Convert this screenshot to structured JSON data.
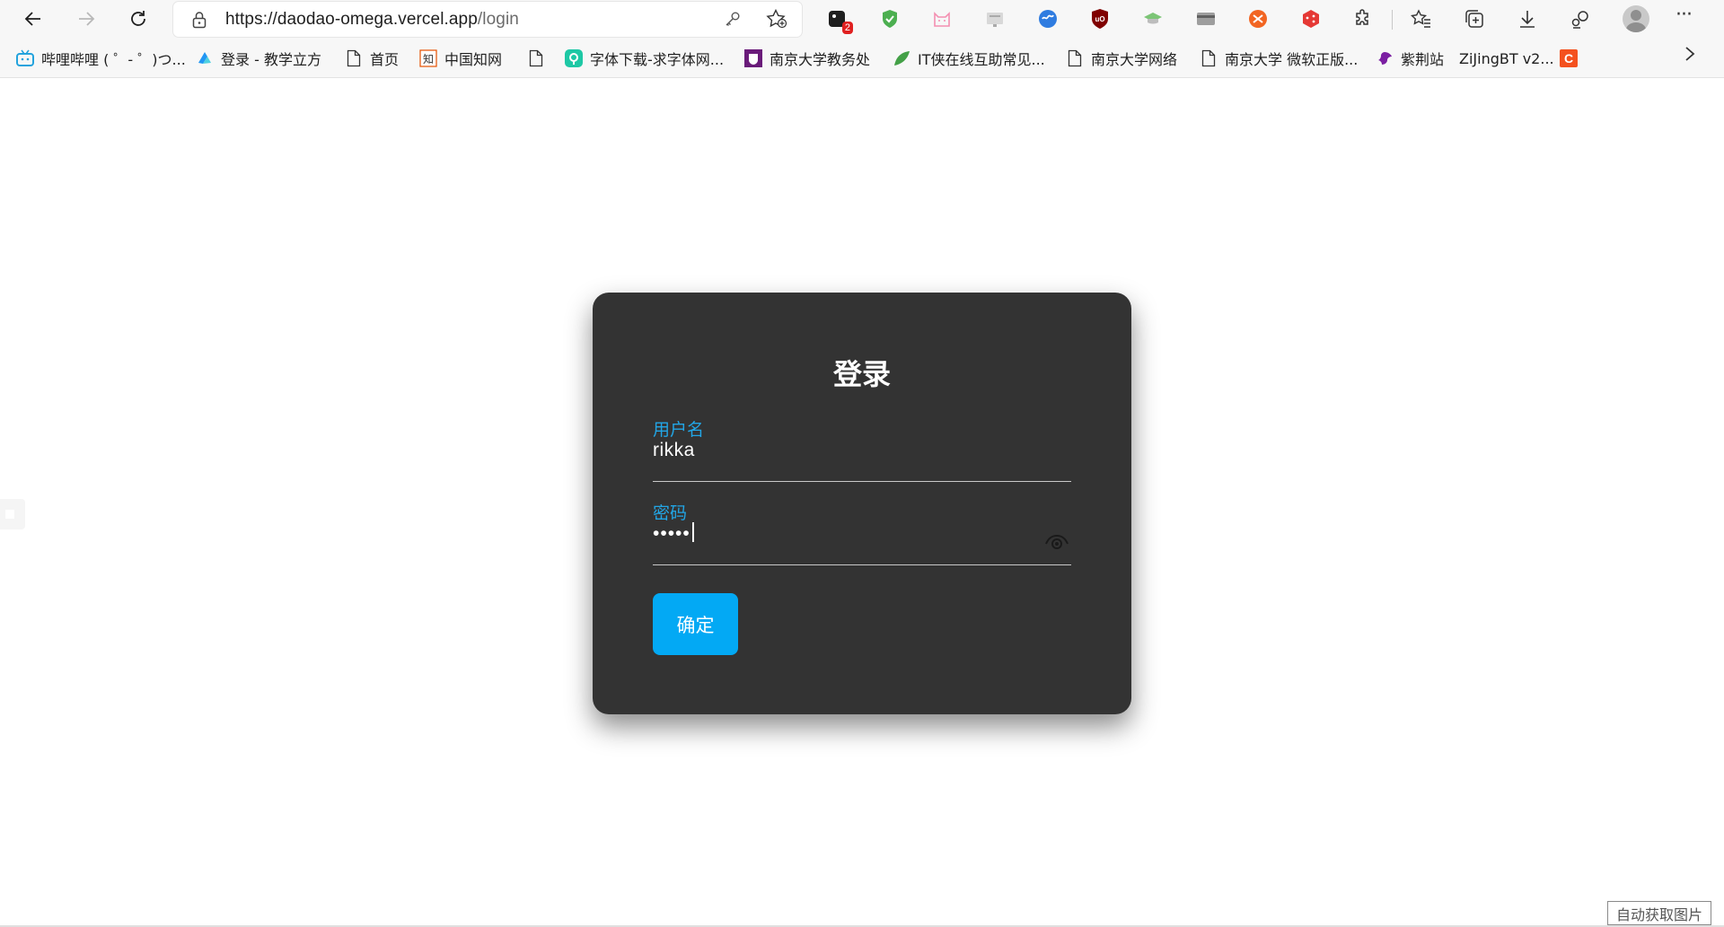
{
  "browser": {
    "url_host": "https://daodao-omega.vercel.app",
    "url_path": "/login",
    "extensions": [
      {
        "icon": "extension-notes-icon",
        "badge": "2"
      },
      {
        "icon": "shield-extension-icon"
      },
      {
        "icon": "cat-extension-icon"
      },
      {
        "icon": "reader-extension-icon"
      },
      {
        "icon": "translate-extension-icon"
      },
      {
        "icon": "ublock-origin-icon"
      },
      {
        "icon": "graduation-cap-icon"
      },
      {
        "icon": "card-extension-icon"
      },
      {
        "icon": "orange-extension-icon"
      },
      {
        "icon": "dice-extension-icon"
      },
      {
        "icon": "puzzle-extensions-icon"
      }
    ]
  },
  "bookmarks": [
    {
      "label": "哔哩哔哩 ( ゜- ゜)つ...",
      "icon": "bilibili-icon"
    },
    {
      "label": "登录 - 教学立方",
      "icon": "teaching-cube-icon"
    },
    {
      "label": "首页",
      "icon": "page-icon"
    },
    {
      "label": "中国知网",
      "icon": "cnki-icon"
    },
    {
      "label": "",
      "icon": "page-icon"
    },
    {
      "label": "字体下载-求字体网...",
      "icon": "qiuziti-icon"
    },
    {
      "label": "南京大学教务处",
      "icon": "nju-icon"
    },
    {
      "label": "IT侠在线互助常见...",
      "icon": "itxia-icon"
    },
    {
      "label": "南京大学网络",
      "icon": "page-icon"
    },
    {
      "label": "南京大学 微软正版...",
      "icon": "page-icon"
    },
    {
      "label": "紫荆站",
      "icon": "zijing-icon"
    },
    {
      "label": "ZiJingBT v2...",
      "icon": ""
    },
    {
      "label": "",
      "icon": "c-icon"
    }
  ],
  "login": {
    "title": "登录",
    "username_label": "用户名",
    "username_value": "rikka",
    "password_label": "密码",
    "password_value": "•••••",
    "submit_label": "确定"
  },
  "page": {
    "auto_fetch_button": "自动获取图片"
  },
  "colors": {
    "card_bg": "#333333",
    "accent": "#03a9f4",
    "label_blue": "#22a6e6"
  }
}
